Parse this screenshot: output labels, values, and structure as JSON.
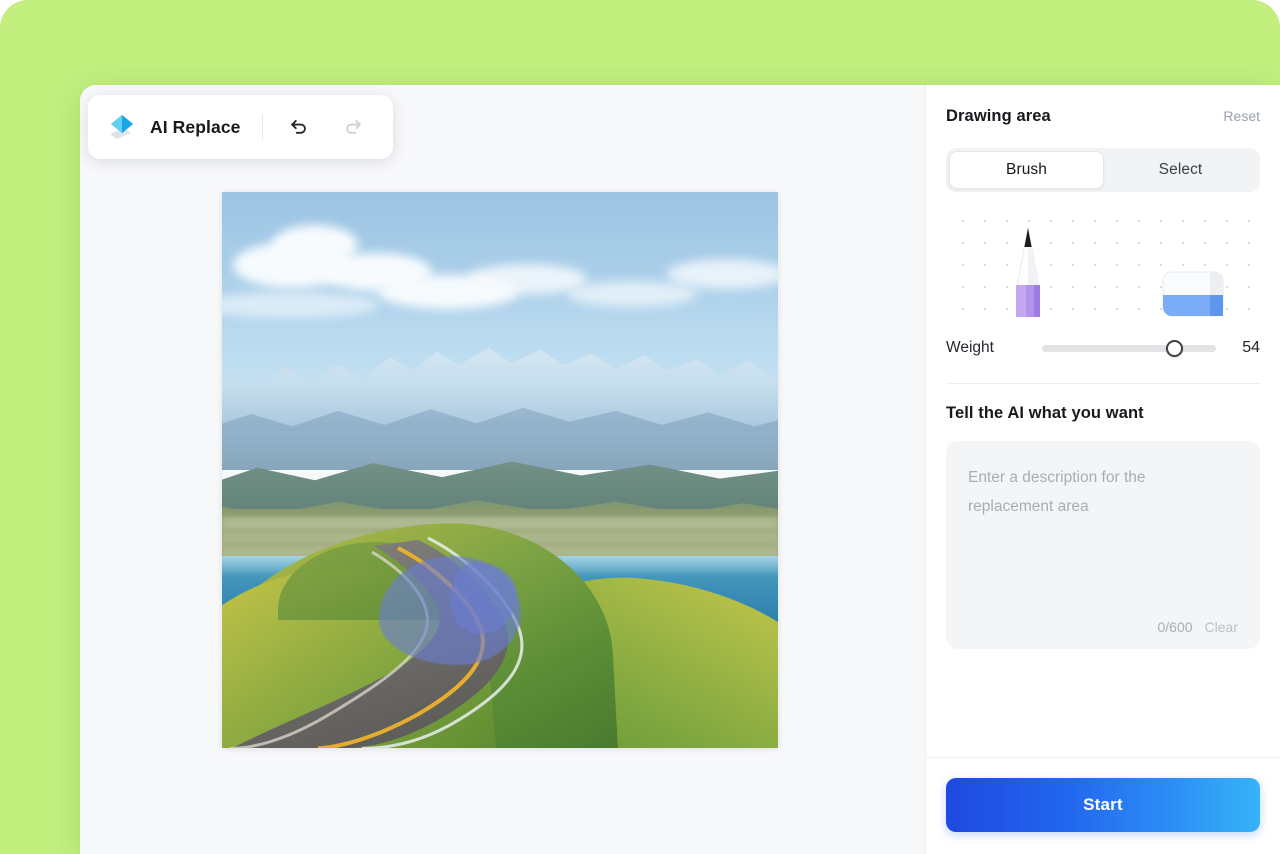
{
  "theme": {
    "background_green": "#c2ef7e",
    "accent_blue": "#2266ef",
    "mask_blue": "#6a7dd4",
    "panel_gray": "#f4f5f7"
  },
  "toolbar": {
    "logo_icon": "eraser-diamond-icon",
    "title": "AI Replace",
    "undo_icon": "undo-arrow-icon",
    "redo_icon": "redo-arrow-icon",
    "undo_enabled": true,
    "redo_enabled": false
  },
  "canvas": {
    "image_alt": "mountain lake road landscape",
    "mask_present": true
  },
  "drawing_area": {
    "title": "Drawing area",
    "reset_label": "Reset",
    "tabs": [
      {
        "label": "Brush",
        "active": true
      },
      {
        "label": "Select",
        "active": false
      }
    ],
    "tools": {
      "pen_icon": "pen-tool-icon",
      "eraser_icon": "eraser-tool-icon"
    },
    "weight": {
      "label": "Weight",
      "value": "54",
      "min": 1,
      "max": 100,
      "percent": 76
    }
  },
  "prompt": {
    "title": "Tell the AI what you want",
    "placeholder": "Enter a description for the replacement area",
    "value": "",
    "counter": "0/600",
    "clear_label": "Clear"
  },
  "footer": {
    "start_label": "Start"
  }
}
